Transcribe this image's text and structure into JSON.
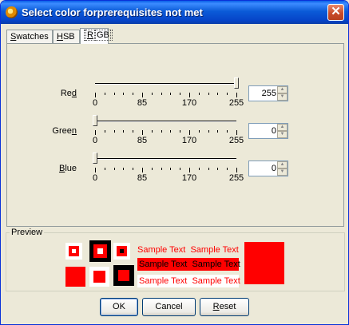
{
  "window": {
    "title": "Select color forprerequisites not met",
    "close_glyph": "✕"
  },
  "tabs": [
    {
      "label_pre": "",
      "mnemonic": "S",
      "label_post": "watches"
    },
    {
      "label_pre": "",
      "mnemonic": "H",
      "label_post": "SB"
    },
    {
      "label_pre": "",
      "mnemonic": "R",
      "label_post": "GB"
    }
  ],
  "active_tab": "RGB",
  "channels": [
    {
      "label_pre": "Re",
      "mnemonic": "d",
      "label_post": "",
      "value": "255",
      "level": 255
    },
    {
      "label_pre": "Gree",
      "mnemonic": "n",
      "label_post": "",
      "value": "0",
      "level": 0
    },
    {
      "label_pre": "",
      "mnemonic": "B",
      "label_post": "lue",
      "value": "0",
      "level": 0
    }
  ],
  "slider": {
    "min": 0,
    "max": 255,
    "tick_labels": [
      "0",
      "85",
      "170",
      "255"
    ]
  },
  "spinner_icons": {
    "up": "▲",
    "down": "▼"
  },
  "preview": {
    "legend": "Preview",
    "sample_text": "Sample Text",
    "color": "#ff0000"
  },
  "buttons": {
    "ok": "OK",
    "cancel": "Cancel",
    "reset_mnemonic": "R",
    "reset_rest": "eset"
  },
  "colors": {
    "title_bar": "#0a5fe8",
    "selected": "#ff0000",
    "dialog_bg": "#ece9d8"
  }
}
